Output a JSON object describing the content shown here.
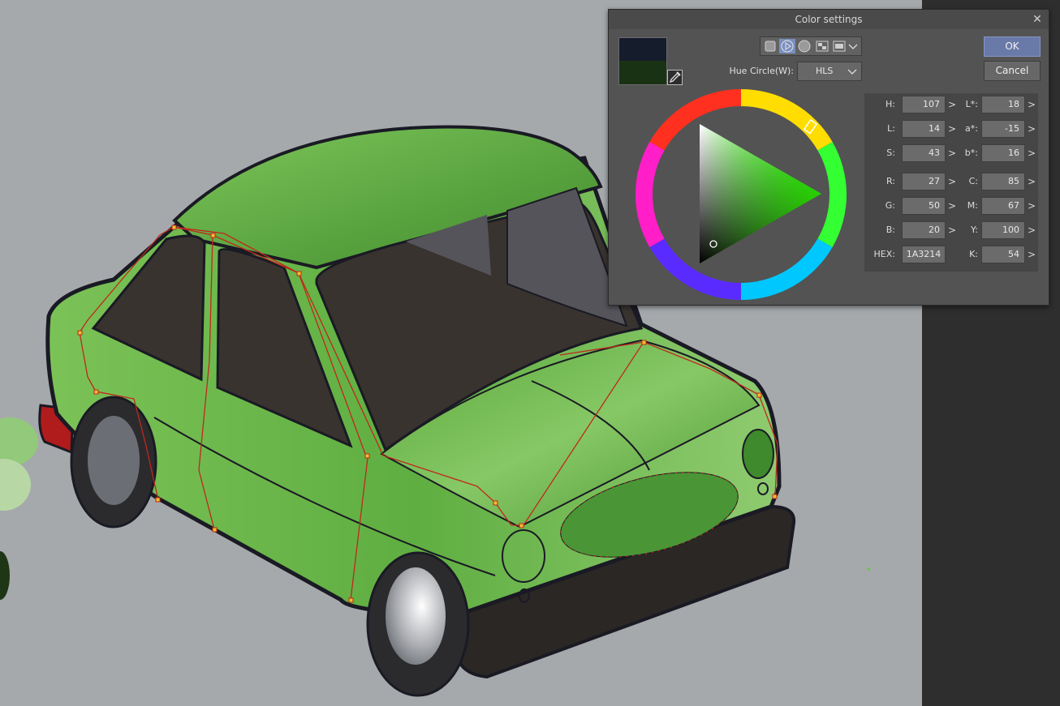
{
  "dialog": {
    "title": "Color settings",
    "close_glyph": "✕",
    "ok_label": "OK",
    "cancel_label": "Cancel",
    "hue_circle_label": "Hue Circle(W):",
    "hue_mode": "HLS",
    "main_color": "#151C2C",
    "sub_color": "#1A3214"
  },
  "values": {
    "H": "107",
    "L": "14",
    "S": "43",
    "R": "27",
    "G": "50",
    "B": "20",
    "HEX": "1A3214",
    "Lstar": "18",
    "astar": "-15",
    "bstar": "16",
    "C": "85",
    "M": "67",
    "Y": "100",
    "K": "54"
  },
  "labels": {
    "H": "H:",
    "L": "L:",
    "S": "S:",
    "R": "R:",
    "G": "G:",
    "B": "B:",
    "HEX": "HEX:",
    "Lstar": "L*:",
    "astar": "a*:",
    "bstar": "b*:",
    "C": "C:",
    "M": "M:",
    "Y": "Y:",
    "K": "K:"
  },
  "icons": {
    "mode_square": "square-icon",
    "mode_play": "play-circle-icon",
    "mode_circle": "circle-icon",
    "mode_image": "image-icon",
    "mode_film": "film-icon",
    "mode_dropdown": "chevron-down-icon",
    "eyedropper": "eyedropper-icon"
  },
  "colors": {
    "canvas_bg": "#A5A9AC",
    "car_body": "#6DB84A",
    "path_red": "#C0281C",
    "accent_ok": "#6A7AA8"
  }
}
